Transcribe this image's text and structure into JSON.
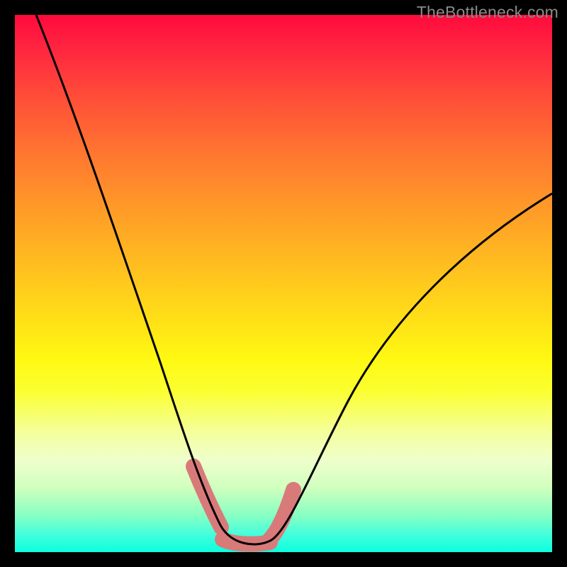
{
  "watermark": "TheBottleneck.com",
  "chart_data": {
    "type": "line",
    "title": "",
    "xlabel": "",
    "ylabel": "",
    "xlim": [
      0,
      100
    ],
    "ylim": [
      0,
      100
    ],
    "series": [
      {
        "name": "curve",
        "x": [
          4,
          10,
          16,
          22,
          28,
          33,
          36,
          38,
          40,
          42,
          46,
          48,
          50,
          54,
          60,
          68,
          78,
          90,
          100
        ],
        "y": [
          100,
          83,
          66,
          49,
          33,
          19,
          11,
          7,
          4,
          2,
          1,
          1,
          2,
          5,
          13,
          26,
          41,
          56,
          67
        ]
      }
    ],
    "highlight_segments": [
      {
        "name": "left-shoulder",
        "x": [
          33.5,
          38.5
        ],
        "y": [
          17,
          5
        ]
      },
      {
        "name": "trough",
        "x": [
          38.5,
          47.5
        ],
        "y": [
          2,
          2
        ]
      },
      {
        "name": "right-shoulder",
        "x": [
          47.5,
          51.5
        ],
        "y": [
          3,
          12
        ]
      }
    ],
    "colors": {
      "curve": "#000000",
      "highlight": "#d97a7a",
      "background_top": "#ff0a3c",
      "background_bottom": "#0cffdc",
      "frame": "#000000"
    }
  }
}
